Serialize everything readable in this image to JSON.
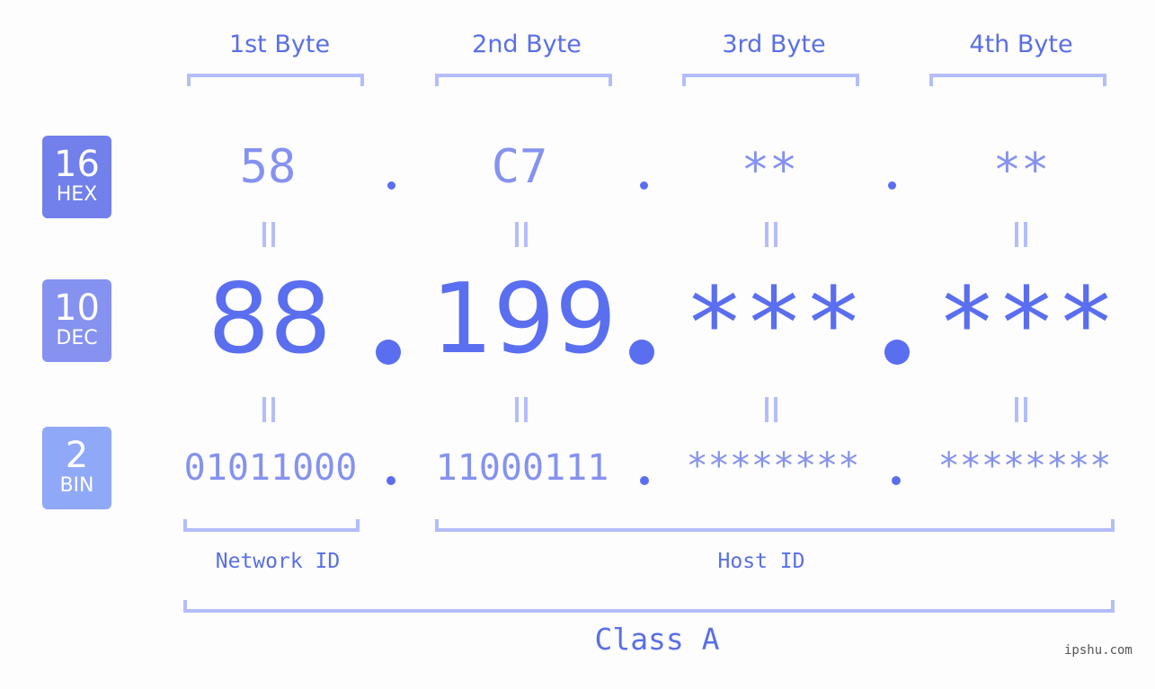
{
  "bytes": {
    "labels": [
      "1st Byte",
      "2nd Byte",
      "3rd Byte",
      "4th Byte"
    ]
  },
  "badges": [
    {
      "base": "16",
      "name": "HEX",
      "color": "#7180eb"
    },
    {
      "base": "10",
      "name": "DEC",
      "color": "#8592ef"
    },
    {
      "base": "2",
      "name": "BIN",
      "color": "#8fa8f7"
    }
  ],
  "hex": [
    "58",
    "C7",
    "**",
    "**"
  ],
  "dec": [
    "88",
    "199",
    "***",
    "***"
  ],
  "bin": [
    "01011000",
    "11000111",
    "********",
    "********"
  ],
  "separator": ".",
  "equals": "=",
  "ids": {
    "network": "Network ID",
    "host": "Host ID"
  },
  "ip_class": "Class A",
  "watermark": "ipshu.com",
  "colors": {
    "primary": "#5a6ef0",
    "secondary": "#8592ef",
    "bracket": "#b4bdfa",
    "background": "#fcfdfc"
  }
}
